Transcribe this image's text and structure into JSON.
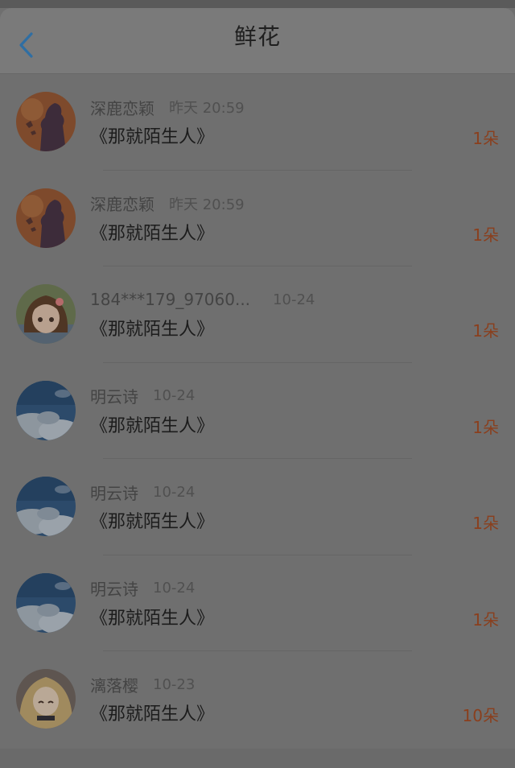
{
  "header": {
    "title": "鲜花",
    "back_icon": "chevron-left-icon",
    "accent_color": "#2f6ea3"
  },
  "count_color": "#8a3f1d",
  "items": [
    {
      "avatar": "anime-silhouette-orange",
      "username": "深鹿恋颖",
      "time": "昨天 20:59",
      "book": "《那就陌生人》",
      "count": "1朵"
    },
    {
      "avatar": "anime-silhouette-orange",
      "username": "深鹿恋颖",
      "time": "昨天 20:59",
      "book": "《那就陌生人》",
      "count": "1朵"
    },
    {
      "avatar": "anime-girl-brown-hair",
      "username": "184***179_97060...",
      "time": "10-24",
      "book": "《那就陌生人》",
      "count": "1朵"
    },
    {
      "avatar": "blue-sky-clouds",
      "username": "明云诗",
      "time": "10-24",
      "book": "《那就陌生人》",
      "count": "1朵"
    },
    {
      "avatar": "blue-sky-clouds",
      "username": "明云诗",
      "time": "10-24",
      "book": "《那就陌生人》",
      "count": "1朵"
    },
    {
      "avatar": "blue-sky-clouds",
      "username": "明云诗",
      "time": "10-24",
      "book": "《那就陌生人》",
      "count": "1朵"
    },
    {
      "avatar": "anime-girl-blonde",
      "username": "漓落樱",
      "time": "10-23",
      "book": "《那就陌生人》",
      "count": "10朵"
    }
  ]
}
